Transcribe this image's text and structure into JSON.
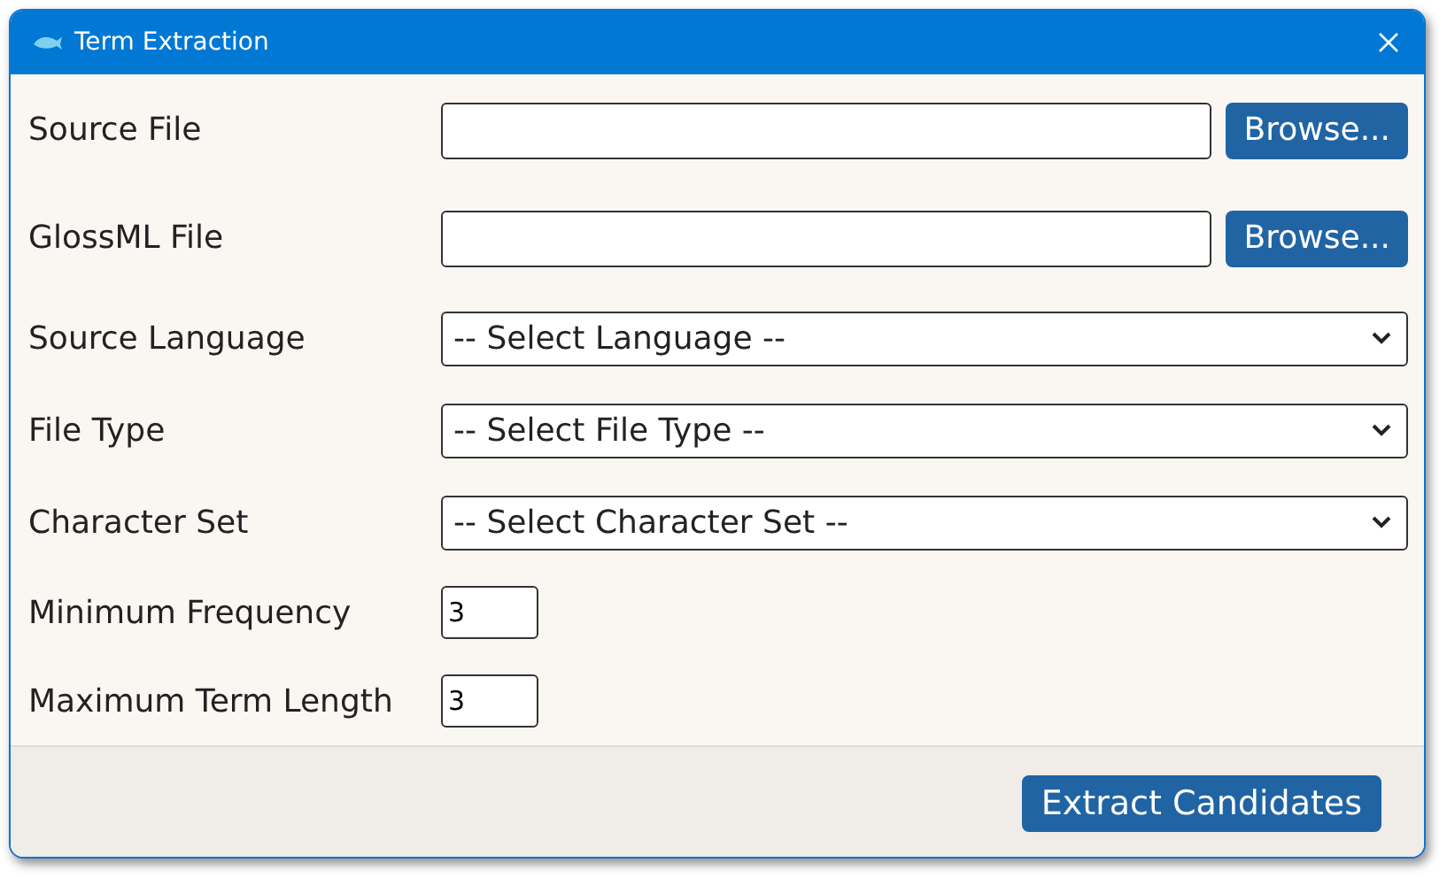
{
  "window": {
    "title": "Term Extraction"
  },
  "fields": [
    {
      "kind": "file",
      "label": "Source File",
      "button": "Browse..."
    },
    {
      "kind": "file",
      "label": "GlossML File",
      "button": "Browse..."
    },
    {
      "kind": "select",
      "label": "Source Language",
      "value": "-- Select Language --"
    },
    {
      "kind": "select",
      "label": "File Type",
      "value": "-- Select File Type --"
    },
    {
      "kind": "select",
      "label": "Character Set",
      "value": "-- Select Character Set --"
    },
    {
      "kind": "number",
      "label": "Minimum Frequency",
      "value": "3"
    },
    {
      "kind": "number",
      "label": "Maximum Term Length",
      "value": "3"
    }
  ],
  "footer": {
    "button": "Extract Candidates"
  }
}
